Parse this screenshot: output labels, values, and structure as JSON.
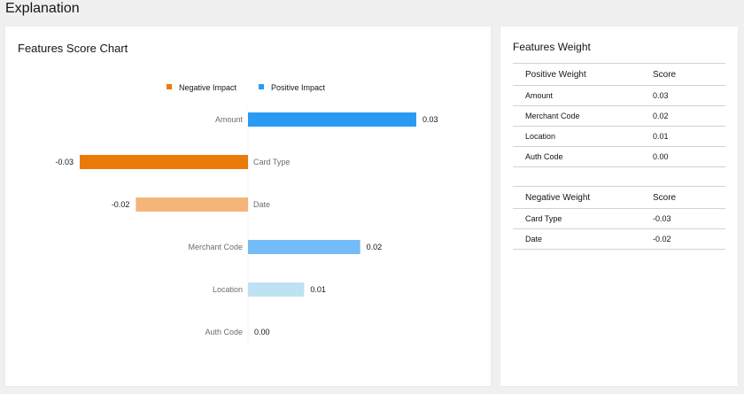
{
  "page": {
    "title": "Explanation"
  },
  "chart_card": {
    "title": "Features Score Chart"
  },
  "chart_data": {
    "type": "bar",
    "orientation": "horizontal",
    "categories": [
      "Amount",
      "Card Type",
      "Date",
      "Merchant Code",
      "Location",
      "Auth Code"
    ],
    "values": [
      0.03,
      -0.03,
      -0.02,
      0.02,
      0.01,
      0.0
    ],
    "value_labels": [
      "0.03",
      "-0.03",
      "-0.02",
      "0.02",
      "0.01",
      "0.00"
    ],
    "bar_colors": [
      "#2b9af3",
      "#ec7a08",
      "#f4b678",
      "#73bcf7",
      "#bee1f4",
      "#bee1f4"
    ],
    "legend": [
      {
        "name": "Negative Impact",
        "color": "#ec7a08"
      },
      {
        "name": "Positive Impact",
        "color": "#2b9af3"
      }
    ],
    "legend_position": "top",
    "xlim": [
      -0.03,
      0.03
    ],
    "grid": false
  },
  "weights_card": {
    "title": "Features Weight",
    "positive": {
      "header": [
        "Positive Weight",
        "Score"
      ],
      "rows": [
        [
          "Amount",
          "0.03"
        ],
        [
          "Merchant Code",
          "0.02"
        ],
        [
          "Location",
          "0.01"
        ],
        [
          "Auth Code",
          "0.00"
        ]
      ]
    },
    "negative": {
      "header": [
        "Negative Weight",
        "Score"
      ],
      "rows": [
        [
          "Card Type",
          "-0.03"
        ],
        [
          "Date",
          "-0.02"
        ]
      ]
    }
  }
}
